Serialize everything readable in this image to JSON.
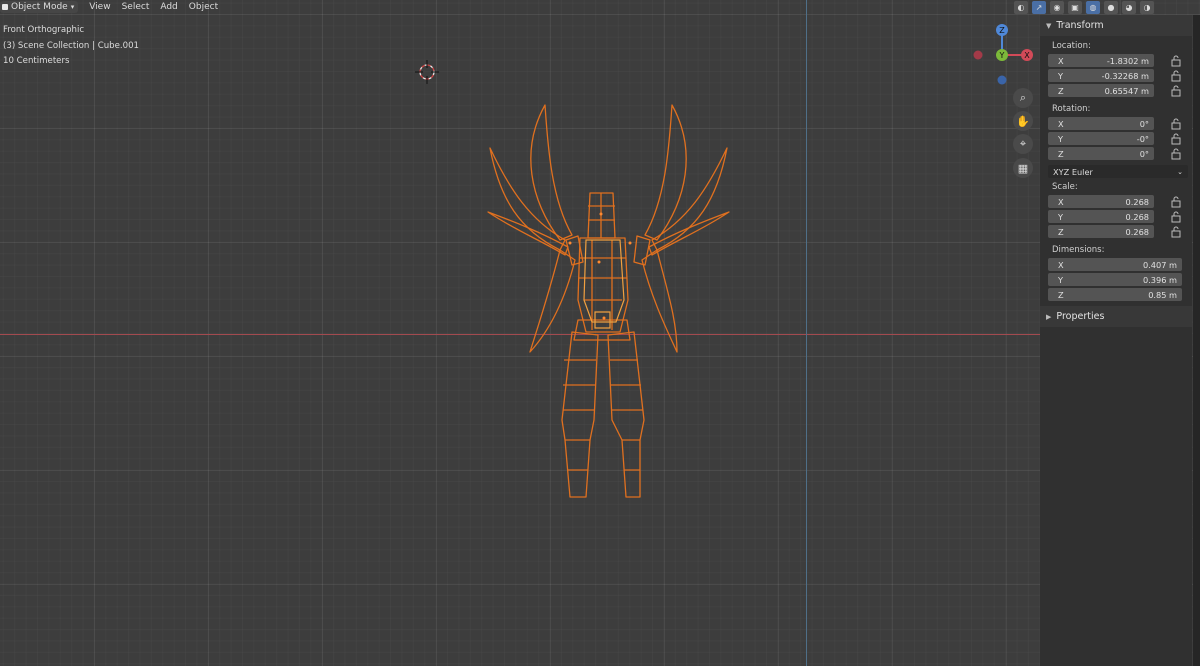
{
  "header": {
    "mode": "Object Mode",
    "menu": [
      "View",
      "Select",
      "Add",
      "Object"
    ]
  },
  "overlay": {
    "view_name": "Front Orthographic",
    "collection": "(3) Scene Collection | Cube.001",
    "scale": "10 Centimeters"
  },
  "gizmo": {
    "z": "Z",
    "y": "Y",
    "x": "X"
  },
  "npanel": {
    "transform_title": "Transform",
    "location_label": "Location:",
    "location": [
      {
        "axis": "X",
        "value": "-1.8302 m"
      },
      {
        "axis": "Y",
        "value": "-0.32268 m"
      },
      {
        "axis": "Z",
        "value": "0.65547 m"
      }
    ],
    "rotation_label": "Rotation:",
    "rotation": [
      {
        "axis": "X",
        "value": "0°"
      },
      {
        "axis": "Y",
        "value": "-0°"
      },
      {
        "axis": "Z",
        "value": "0°"
      }
    ],
    "rotation_mode": "XYZ Euler",
    "scale_label": "Scale:",
    "scale": [
      {
        "axis": "X",
        "value": "0.268"
      },
      {
        "axis": "Y",
        "value": "0.268"
      },
      {
        "axis": "Z",
        "value": "0.268"
      }
    ],
    "dimensions_label": "Dimensions:",
    "dimensions": [
      {
        "axis": "X",
        "value": "0.407 m"
      },
      {
        "axis": "Y",
        "value": "0.396 m"
      },
      {
        "axis": "Z",
        "value": "0.85 m"
      }
    ],
    "properties_title": "Properties"
  },
  "colors": {
    "wire": "#e0701f",
    "wire_light": "#f0a040",
    "x_axis": "#a34a4f",
    "z_axis": "#4f6f88"
  }
}
